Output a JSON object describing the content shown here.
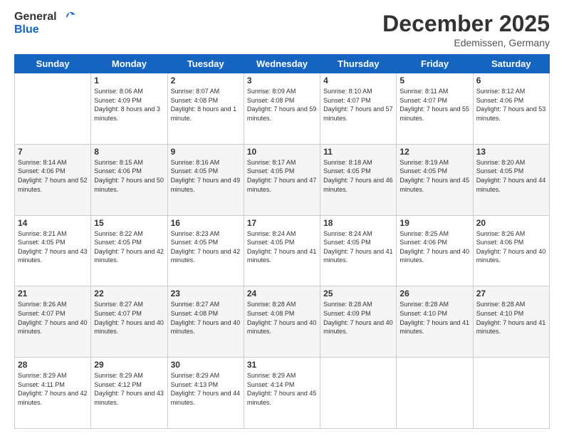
{
  "header": {
    "logo_general": "General",
    "logo_blue": "Blue",
    "month_title": "December 2025",
    "subtitle": "Edemissen, Germany"
  },
  "columns": [
    "Sunday",
    "Monday",
    "Tuesday",
    "Wednesday",
    "Thursday",
    "Friday",
    "Saturday"
  ],
  "weeks": [
    {
      "shaded": false,
      "days": [
        {
          "num": "",
          "sunrise": "",
          "sunset": "",
          "daylight": ""
        },
        {
          "num": "1",
          "sunrise": "Sunrise: 8:06 AM",
          "sunset": "Sunset: 4:09 PM",
          "daylight": "Daylight: 8 hours and 3 minutes."
        },
        {
          "num": "2",
          "sunrise": "Sunrise: 8:07 AM",
          "sunset": "Sunset: 4:08 PM",
          "daylight": "Daylight: 8 hours and 1 minute."
        },
        {
          "num": "3",
          "sunrise": "Sunrise: 8:09 AM",
          "sunset": "Sunset: 4:08 PM",
          "daylight": "Daylight: 7 hours and 59 minutes."
        },
        {
          "num": "4",
          "sunrise": "Sunrise: 8:10 AM",
          "sunset": "Sunset: 4:07 PM",
          "daylight": "Daylight: 7 hours and 57 minutes."
        },
        {
          "num": "5",
          "sunrise": "Sunrise: 8:11 AM",
          "sunset": "Sunset: 4:07 PM",
          "daylight": "Daylight: 7 hours and 55 minutes."
        },
        {
          "num": "6",
          "sunrise": "Sunrise: 8:12 AM",
          "sunset": "Sunset: 4:06 PM",
          "daylight": "Daylight: 7 hours and 53 minutes."
        }
      ]
    },
    {
      "shaded": true,
      "days": [
        {
          "num": "7",
          "sunrise": "Sunrise: 8:14 AM",
          "sunset": "Sunset: 4:06 PM",
          "daylight": "Daylight: 7 hours and 52 minutes."
        },
        {
          "num": "8",
          "sunrise": "Sunrise: 8:15 AM",
          "sunset": "Sunset: 4:06 PM",
          "daylight": "Daylight: 7 hours and 50 minutes."
        },
        {
          "num": "9",
          "sunrise": "Sunrise: 8:16 AM",
          "sunset": "Sunset: 4:05 PM",
          "daylight": "Daylight: 7 hours and 49 minutes."
        },
        {
          "num": "10",
          "sunrise": "Sunrise: 8:17 AM",
          "sunset": "Sunset: 4:05 PM",
          "daylight": "Daylight: 7 hours and 47 minutes."
        },
        {
          "num": "11",
          "sunrise": "Sunrise: 8:18 AM",
          "sunset": "Sunset: 4:05 PM",
          "daylight": "Daylight: 7 hours and 46 minutes."
        },
        {
          "num": "12",
          "sunrise": "Sunrise: 8:19 AM",
          "sunset": "Sunset: 4:05 PM",
          "daylight": "Daylight: 7 hours and 45 minutes."
        },
        {
          "num": "13",
          "sunrise": "Sunrise: 8:20 AM",
          "sunset": "Sunset: 4:05 PM",
          "daylight": "Daylight: 7 hours and 44 minutes."
        }
      ]
    },
    {
      "shaded": false,
      "days": [
        {
          "num": "14",
          "sunrise": "Sunrise: 8:21 AM",
          "sunset": "Sunset: 4:05 PM",
          "daylight": "Daylight: 7 hours and 43 minutes."
        },
        {
          "num": "15",
          "sunrise": "Sunrise: 8:22 AM",
          "sunset": "Sunset: 4:05 PM",
          "daylight": "Daylight: 7 hours and 42 minutes."
        },
        {
          "num": "16",
          "sunrise": "Sunrise: 8:23 AM",
          "sunset": "Sunset: 4:05 PM",
          "daylight": "Daylight: 7 hours and 42 minutes."
        },
        {
          "num": "17",
          "sunrise": "Sunrise: 8:24 AM",
          "sunset": "Sunset: 4:05 PM",
          "daylight": "Daylight: 7 hours and 41 minutes."
        },
        {
          "num": "18",
          "sunrise": "Sunrise: 8:24 AM",
          "sunset": "Sunset: 4:05 PM",
          "daylight": "Daylight: 7 hours and 41 minutes."
        },
        {
          "num": "19",
          "sunrise": "Sunrise: 8:25 AM",
          "sunset": "Sunset: 4:06 PM",
          "daylight": "Daylight: 7 hours and 40 minutes."
        },
        {
          "num": "20",
          "sunrise": "Sunrise: 8:26 AM",
          "sunset": "Sunset: 4:06 PM",
          "daylight": "Daylight: 7 hours and 40 minutes."
        }
      ]
    },
    {
      "shaded": true,
      "days": [
        {
          "num": "21",
          "sunrise": "Sunrise: 8:26 AM",
          "sunset": "Sunset: 4:07 PM",
          "daylight": "Daylight: 7 hours and 40 minutes."
        },
        {
          "num": "22",
          "sunrise": "Sunrise: 8:27 AM",
          "sunset": "Sunset: 4:07 PM",
          "daylight": "Daylight: 7 hours and 40 minutes."
        },
        {
          "num": "23",
          "sunrise": "Sunrise: 8:27 AM",
          "sunset": "Sunset: 4:08 PM",
          "daylight": "Daylight: 7 hours and 40 minutes."
        },
        {
          "num": "24",
          "sunrise": "Sunrise: 8:28 AM",
          "sunset": "Sunset: 4:08 PM",
          "daylight": "Daylight: 7 hours and 40 minutes."
        },
        {
          "num": "25",
          "sunrise": "Sunrise: 8:28 AM",
          "sunset": "Sunset: 4:09 PM",
          "daylight": "Daylight: 7 hours and 40 minutes."
        },
        {
          "num": "26",
          "sunrise": "Sunrise: 8:28 AM",
          "sunset": "Sunset: 4:10 PM",
          "daylight": "Daylight: 7 hours and 41 minutes."
        },
        {
          "num": "27",
          "sunrise": "Sunrise: 8:28 AM",
          "sunset": "Sunset: 4:10 PM",
          "daylight": "Daylight: 7 hours and 41 minutes."
        }
      ]
    },
    {
      "shaded": false,
      "days": [
        {
          "num": "28",
          "sunrise": "Sunrise: 8:29 AM",
          "sunset": "Sunset: 4:11 PM",
          "daylight": "Daylight: 7 hours and 42 minutes."
        },
        {
          "num": "29",
          "sunrise": "Sunrise: 8:29 AM",
          "sunset": "Sunset: 4:12 PM",
          "daylight": "Daylight: 7 hours and 43 minutes."
        },
        {
          "num": "30",
          "sunrise": "Sunrise: 8:29 AM",
          "sunset": "Sunset: 4:13 PM",
          "daylight": "Daylight: 7 hours and 44 minutes."
        },
        {
          "num": "31",
          "sunrise": "Sunrise: 8:29 AM",
          "sunset": "Sunset: 4:14 PM",
          "daylight": "Daylight: 7 hours and 45 minutes."
        },
        {
          "num": "",
          "sunrise": "",
          "sunset": "",
          "daylight": ""
        },
        {
          "num": "",
          "sunrise": "",
          "sunset": "",
          "daylight": ""
        },
        {
          "num": "",
          "sunrise": "",
          "sunset": "",
          "daylight": ""
        }
      ]
    }
  ]
}
